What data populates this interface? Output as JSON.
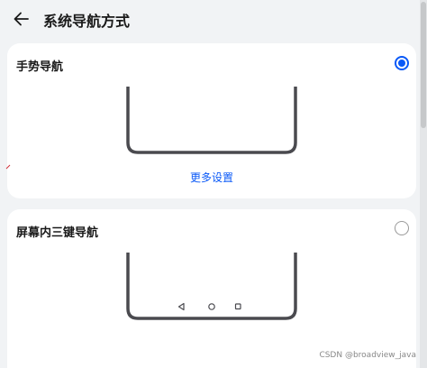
{
  "header": {
    "title": "系统导航方式",
    "back_icon": "arrow-left-icon"
  },
  "options": [
    {
      "label": "手势导航",
      "selected": true,
      "more_settings_label": "更多设置"
    },
    {
      "label": "屏幕内三键导航",
      "selected": false,
      "nav_icons": [
        "back-triangle-icon",
        "home-circle-icon",
        "recents-square-icon"
      ]
    }
  ],
  "watermark": "CSDN @broadview_java",
  "colors": {
    "accent": "#0a59f7",
    "background": "#f1f3f5",
    "card": "#ffffff",
    "illustration_stroke": "#4a4a4f"
  }
}
